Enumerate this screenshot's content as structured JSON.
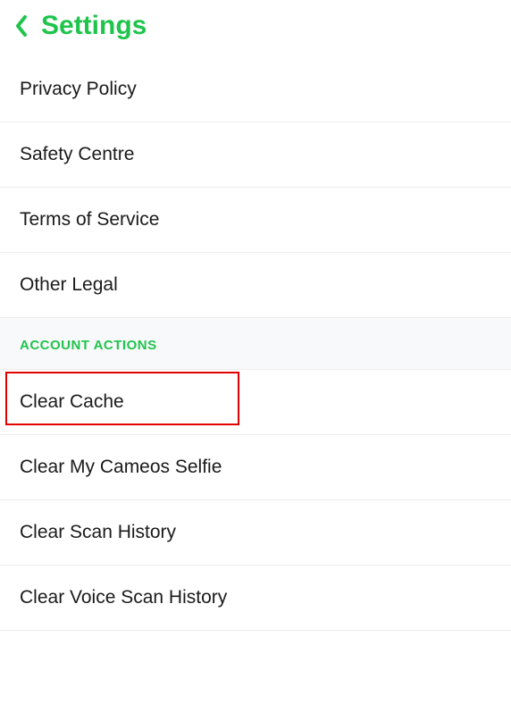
{
  "header": {
    "title": "Settings"
  },
  "legal_items": [
    {
      "label": "Privacy Policy"
    },
    {
      "label": "Safety Centre"
    },
    {
      "label": "Terms of Service"
    },
    {
      "label": "Other Legal"
    }
  ],
  "section_header": "ACCOUNT ACTIONS",
  "account_items": [
    {
      "label": "Clear Cache"
    },
    {
      "label": "Clear My Cameos Selfie"
    },
    {
      "label": "Clear Scan History"
    },
    {
      "label": "Clear Voice Scan History"
    }
  ]
}
